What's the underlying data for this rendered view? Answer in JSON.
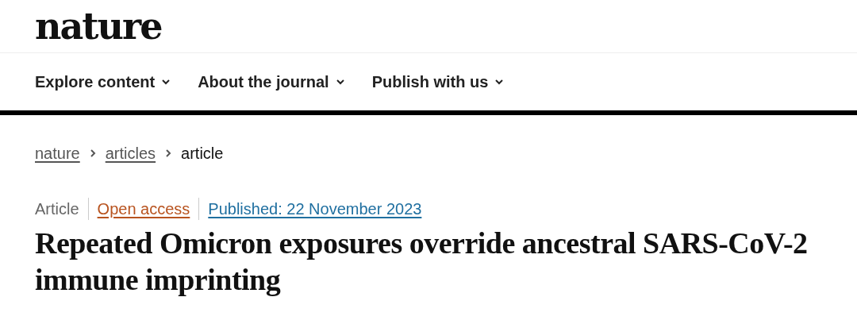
{
  "header": {
    "logo": "nature"
  },
  "nav": [
    {
      "label": "Explore content"
    },
    {
      "label": "About the journal"
    },
    {
      "label": "Publish with us"
    }
  ],
  "breadcrumb": [
    {
      "label": "nature",
      "kind": "link"
    },
    {
      "label": "articles",
      "kind": "link"
    },
    {
      "label": "article",
      "kind": "current"
    }
  ],
  "article": {
    "meta": [
      {
        "label": "Article",
        "kind": "type"
      },
      {
        "label": "Open access",
        "kind": "access"
      },
      {
        "label": "Published: 22 November 2023",
        "kind": "date"
      }
    ],
    "title": "Repeated Omicron exposures override ancestral SARS-CoV-2 immune imprinting"
  }
}
